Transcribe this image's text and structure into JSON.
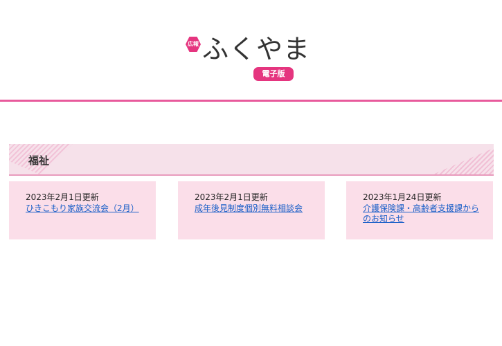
{
  "header": {
    "logo_mark": "広報",
    "logo_title": "ふくやま",
    "logo_badge": "電子版"
  },
  "section": {
    "title": "福祉"
  },
  "articles": [
    {
      "date": "2023年2月1日更新",
      "title": "ひきこもり家族交流会（2月）"
    },
    {
      "date": "2023年2月1日更新",
      "title": "成年後見制度個別無料相談会"
    },
    {
      "date": "2023年1月24日更新",
      "title": "介護保険課・高齢者支援課からのお知らせ"
    }
  ],
  "colors": {
    "accent": "#e5357f",
    "header_line": "#e85a9c",
    "section_bg": "#f6e1ea",
    "card_bg": "#fbdee9",
    "link": "#1a5fc8"
  }
}
